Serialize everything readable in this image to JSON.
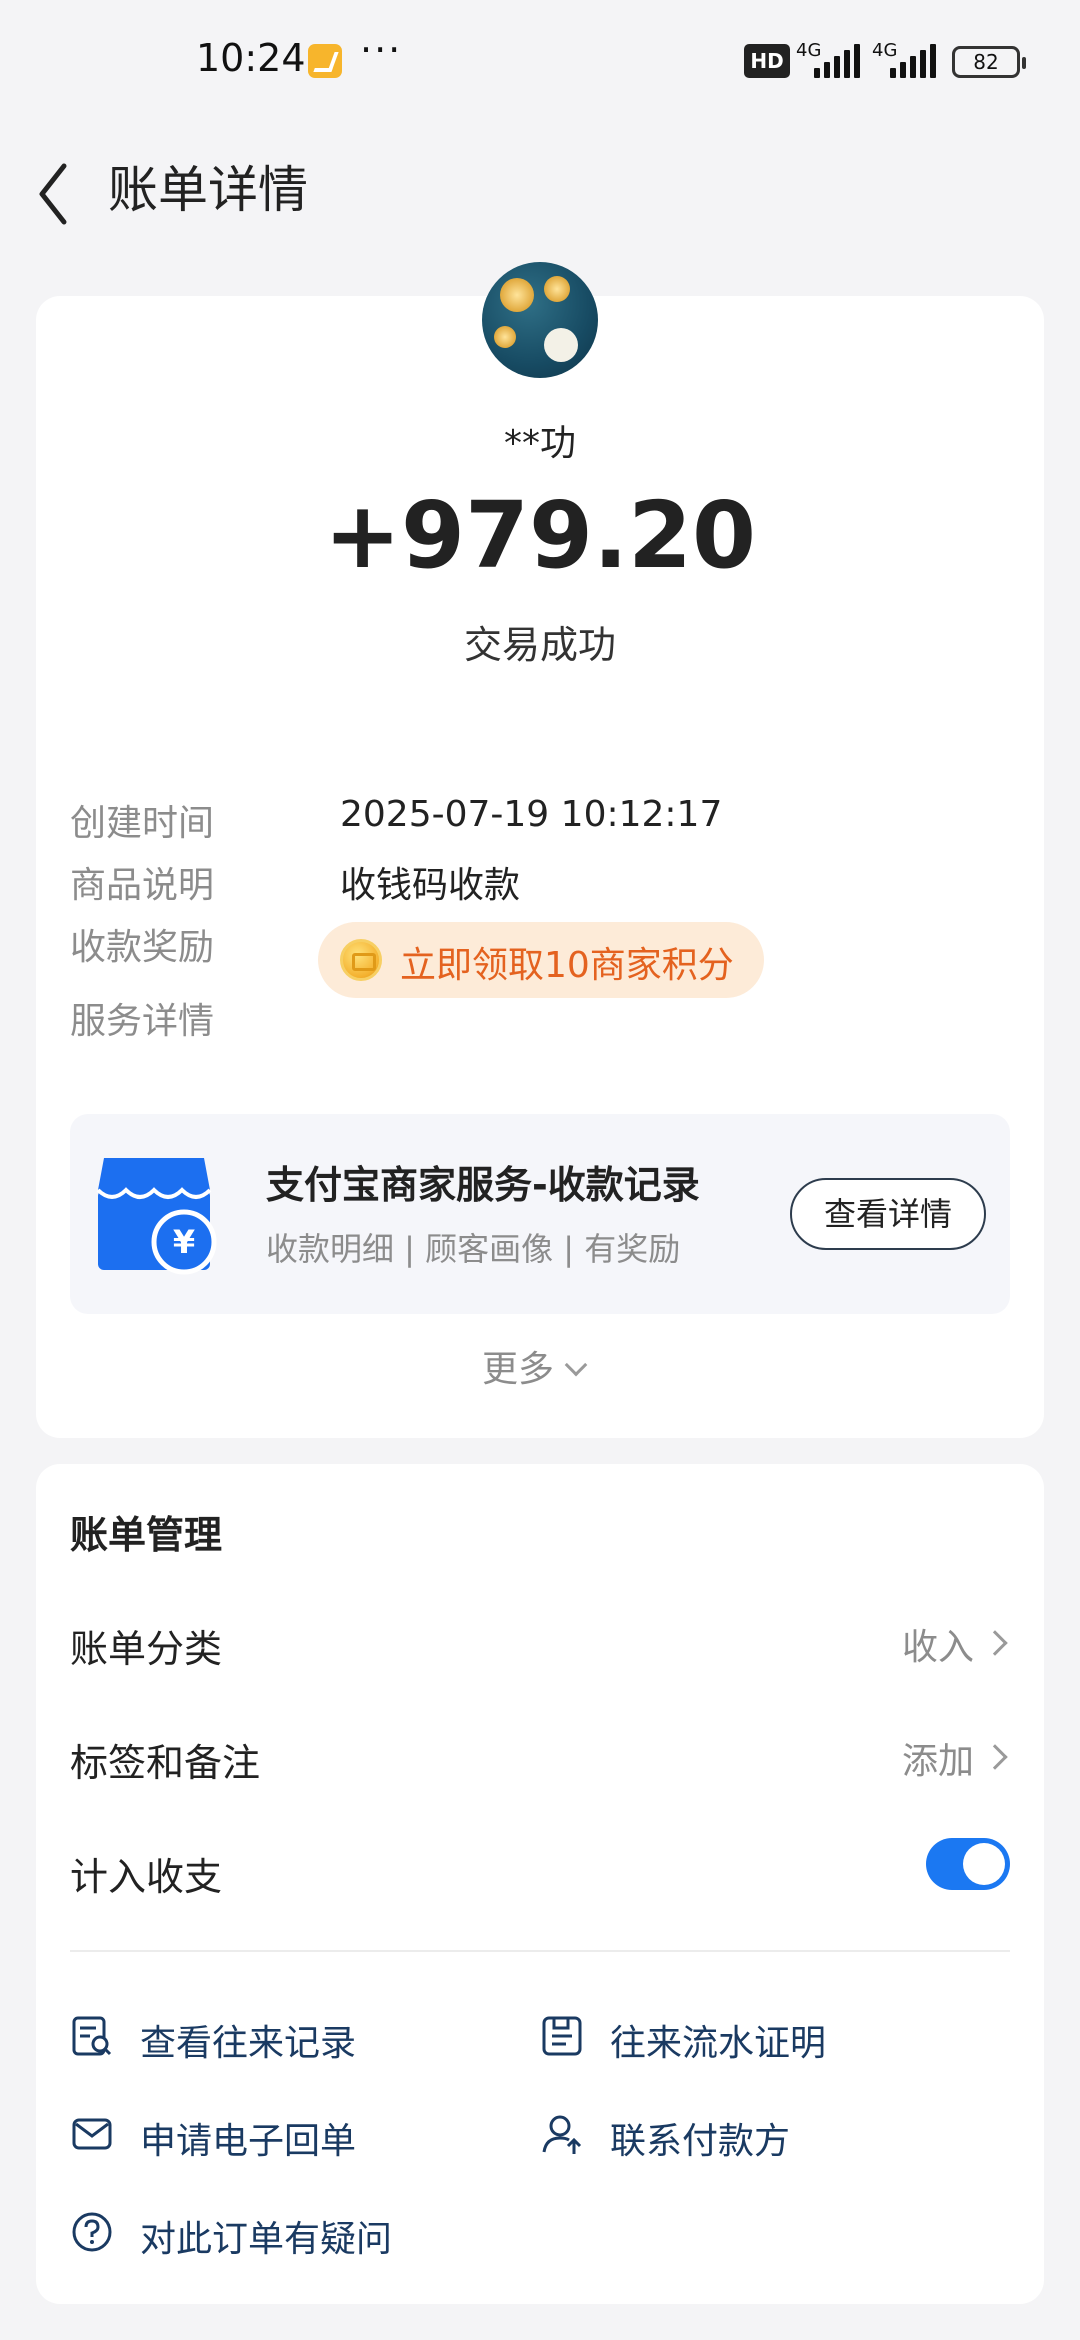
{
  "status_bar": {
    "time": "10:24",
    "more": "···",
    "hd": "HD",
    "network_1": "4G",
    "network_2": "4G",
    "battery": "82",
    "notification_icon": "note-app-icon"
  },
  "header": {
    "back_icon": "chevron-left-icon",
    "title": "账单详情"
  },
  "transaction": {
    "payer_name": "**功",
    "amount": "+979.20",
    "status": "交易成功",
    "fields": [
      {
        "label": "创建时间",
        "value": "2025-07-19 10:12:17"
      },
      {
        "label": "商品说明",
        "value": "收钱码收款"
      },
      {
        "label": "收款奖励",
        "value": ""
      },
      {
        "label": "服务详情",
        "value": ""
      }
    ],
    "reward_text": "立即领取10商家积分",
    "reward_icon": "coin-icon"
  },
  "service": {
    "icon": "store-icon",
    "title": "支付宝商家服务-收款记录",
    "subtitle": "收款明细 | 顾客画像 | 有奖励",
    "button": "查看详情"
  },
  "more": {
    "label": "更多",
    "icon": "chevron-down-icon"
  },
  "management": {
    "title": "账单管理",
    "rows": [
      {
        "label": "账单分类",
        "value": "收入"
      },
      {
        "label": "标签和备注",
        "value": "添加"
      },
      {
        "label": "计入收支",
        "value": "",
        "toggle_on": true
      }
    ],
    "actions": [
      {
        "label": "查看往来记录",
        "icon": "record-search-icon"
      },
      {
        "label": "往来流水证明",
        "icon": "statement-proof-icon"
      },
      {
        "label": "申请电子回单",
        "icon": "mail-icon"
      },
      {
        "label": "联系付款方",
        "icon": "contact-user-icon"
      },
      {
        "label": "对此订单有疑问",
        "icon": "question-icon"
      }
    ]
  },
  "colors": {
    "accent_blue": "#1b78f2",
    "reward_orange": "#e4621f",
    "reward_bg": "#fdebd8",
    "action_text": "#1a3a62"
  }
}
